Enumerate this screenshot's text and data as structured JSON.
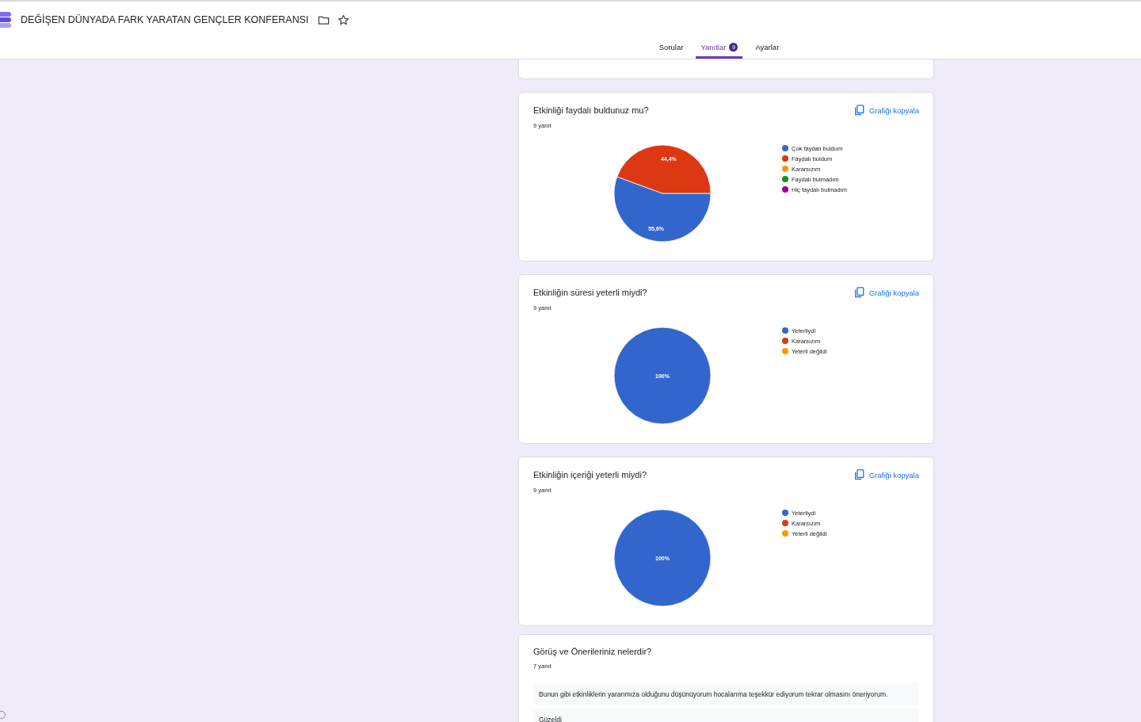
{
  "header": {
    "title": "DEĞİŞEN DÜNYADA FARK YARATAN GENÇLER KONFERANSI",
    "tabs": [
      {
        "label": "Sorular",
        "selected": false
      },
      {
        "label": "Yanıtlar",
        "selected": true,
        "badge": "9"
      },
      {
        "label": "Ayarlar",
        "selected": false
      }
    ]
  },
  "questions": [
    {
      "kind": "chart",
      "title": "Etkinliği faydalı buldunuz mu?",
      "count": "9 yanıt",
      "copy_label": "Grafiği kopyala",
      "chart_data": {
        "type": "pie",
        "categories": [
          "Çok faydalı buldum",
          "Faydalı buldum",
          "Kararsızım",
          "Faydalı bulmadım",
          "Hiç faydalı bulmadım"
        ],
        "values": [
          55.6,
          44.4,
          0,
          0,
          0
        ],
        "colors": [
          "#3366cc",
          "#dc3912",
          "#ff9900",
          "#109618",
          "#990099"
        ],
        "value_labels": [
          "55,6%",
          "44,4%",
          null,
          null,
          null
        ],
        "legend": "right"
      }
    },
    {
      "kind": "chart",
      "title": "Etkinliğin süresi yeterli miydi?",
      "count": "9 yanıt",
      "copy_label": "Grafiği kopyala",
      "chart_data": {
        "type": "pie",
        "categories": [
          "Yeterliydi",
          "Kararsızım",
          "Yeterli değildi"
        ],
        "values": [
          100,
          0,
          0
        ],
        "colors": [
          "#3366cc",
          "#dc3912",
          "#ff9900"
        ],
        "value_labels": [
          "100%",
          null,
          null
        ],
        "legend": "right"
      }
    },
    {
      "kind": "chart",
      "title": "Etkinliğin içeriği yeterli miydi?",
      "count": "9 yanıt",
      "copy_label": "Grafiği kopyala",
      "chart_data": {
        "type": "pie",
        "categories": [
          "Yeterliydi",
          "Kararsızım",
          "Yeterli değildi"
        ],
        "values": [
          100,
          0,
          0
        ],
        "colors": [
          "#3366cc",
          "#dc3912",
          "#ff9900"
        ],
        "value_labels": [
          "100%",
          null,
          null
        ],
        "legend": "right"
      }
    },
    {
      "kind": "text",
      "title": "Görüş ve Önerileriniz nelerdir?",
      "count": "7 yanıt",
      "responses": [
        "Bunun gibi etkinliklerin yararımıza olduğunu düşünüyorum hocalarıma teşekkür ediyorum tekrar olmasını öneriyorum.",
        "Güzeldi"
      ]
    }
  ]
}
